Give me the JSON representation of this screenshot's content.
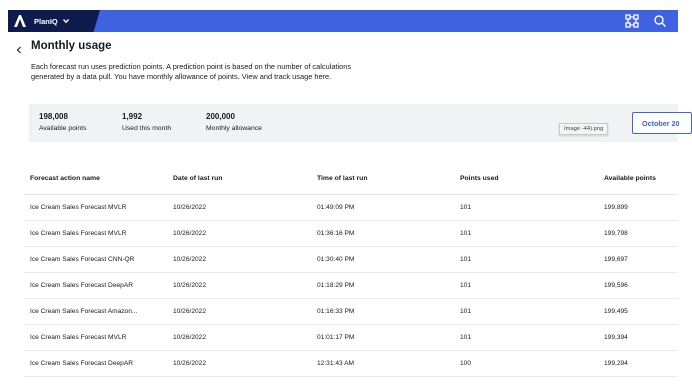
{
  "header": {
    "app_name": "PlanIQ",
    "icons": [
      "brand-logo-icon",
      "chevron-down-icon",
      "apps-grid-icon",
      "search-icon"
    ],
    "colors": {
      "bar": "#3f62e0",
      "brand_block": "#0f1b4c"
    }
  },
  "page": {
    "title": "Monthly usage",
    "description": "Each forecast run uses prediction points. A prediction point is based on the number of calculations generated by a data pull. You have monthly allowance of points. View and track usage here."
  },
  "summary": {
    "available": {
      "value": "198,008",
      "label": "Available points"
    },
    "used": {
      "value": "1,992",
      "label": "Used this month"
    },
    "allowance": {
      "value": "200,000",
      "label": "Monthly allowance"
    },
    "month_button": "October 20",
    "tooltip": "Image -44).png"
  },
  "table": {
    "columns": [
      "Forecast action name",
      "Date of last run",
      "Time of last run",
      "Points used",
      "Available points"
    ],
    "rows": [
      [
        "Ice Cream Sales Forecast MVLR",
        "10/26/2022",
        "01:49:09 PM",
        "101",
        "199,899"
      ],
      [
        "Ice Cream Sales Forecast MVLR",
        "10/26/2022",
        "01:36:16 PM",
        "101",
        "199,798"
      ],
      [
        "Ice Cream Sales Forecast CNN-QR",
        "10/26/2022",
        "01:30:40 PM",
        "101",
        "199,697"
      ],
      [
        "Ice Cream Sales Forecast DeepAR",
        "10/26/2022",
        "01:18:29 PM",
        "101",
        "199,596"
      ],
      [
        "Ice Cream Sales Forecast Amazon...",
        "10/26/2022",
        "01:16:33 PM",
        "101",
        "199,495"
      ],
      [
        "Ice Cream Sales Forecast MVLR",
        "10/26/2022",
        "01:01:17 PM",
        "101",
        "199,394"
      ],
      [
        "Ice Cream Sales Forecast DeepAR",
        "10/26/2022",
        "12:31:43 AM",
        "100",
        "199,294"
      ]
    ]
  }
}
